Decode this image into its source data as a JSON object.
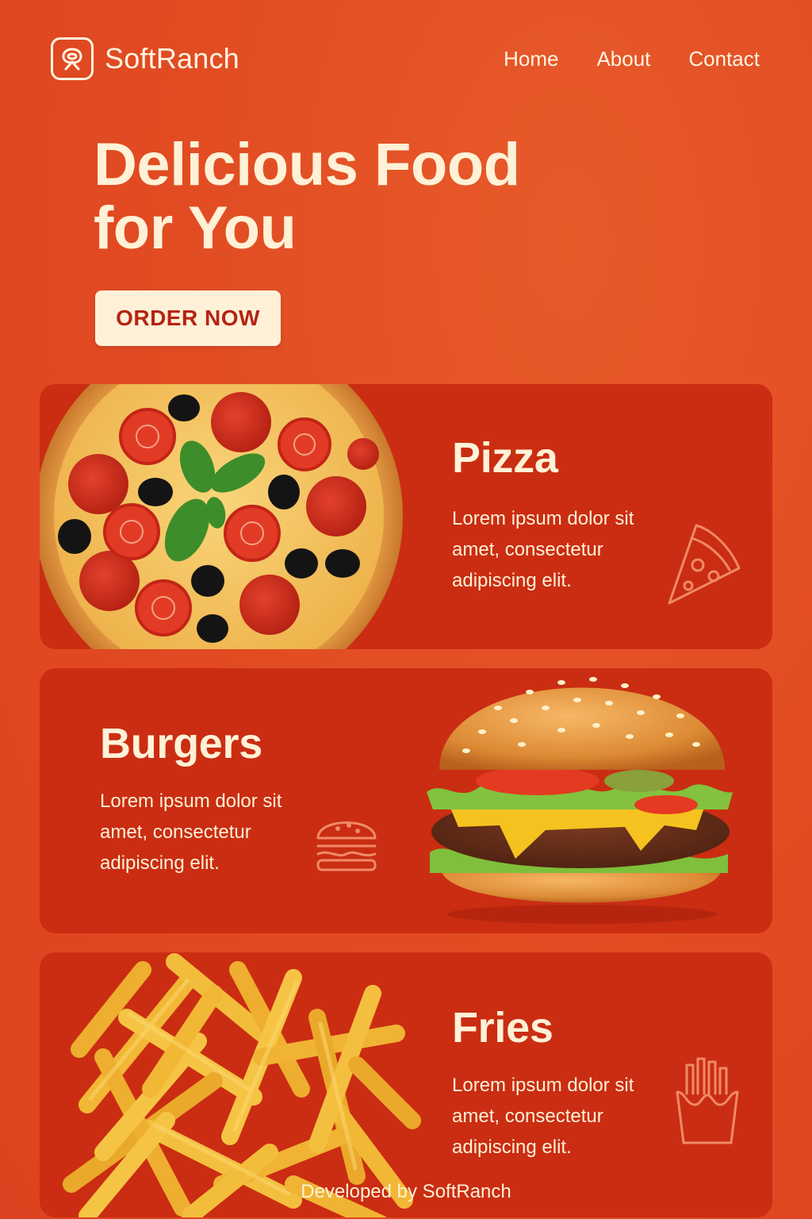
{
  "brand": {
    "name": "SoftRanch"
  },
  "nav": {
    "items": [
      "Home",
      "About",
      "Contact"
    ]
  },
  "hero": {
    "title_line1": "Delicious Food",
    "title_line2": "for You",
    "cta_label": "ORDER NOW"
  },
  "cards": [
    {
      "title": "Pizza",
      "description": "Lorem ipsum dolor sit amet, consectetur adipiscing elit.",
      "icon": "pizza-slice-icon"
    },
    {
      "title": "Burgers",
      "description": "Lorem ipsum dolor sit amet, consectetur adipiscing elit.",
      "icon": "burger-icon"
    },
    {
      "title": "Fries",
      "description": "Lorem ipsum dolor sit amet, consectetur adipiscing elit.",
      "icon": "fries-icon"
    }
  ],
  "footer": {
    "text": "Developed by SoftRanch"
  },
  "colors": {
    "background": "#e14a22",
    "card": "#ca2d12",
    "cream": "#fff1d6",
    "button_text": "#b62412"
  }
}
